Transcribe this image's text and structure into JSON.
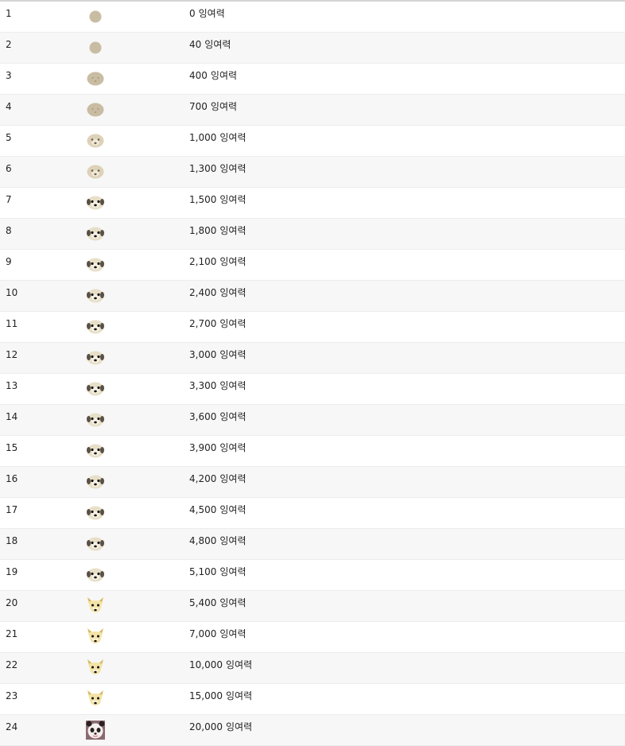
{
  "table": {
    "rows": [
      {
        "level": "1",
        "icon": "blank-circle-icon",
        "amount": "0",
        "unit": "잉여력"
      },
      {
        "level": "2",
        "icon": "blank-circle-icon",
        "amount": "40",
        "unit": "잉여력"
      },
      {
        "level": "3",
        "icon": "faint-face-icon",
        "amount": "400",
        "unit": "잉여력"
      },
      {
        "level": "4",
        "icon": "faint-face-icon",
        "amount": "700",
        "unit": "잉여력"
      },
      {
        "level": "5",
        "icon": "light-dog-face-icon",
        "amount": "1,000",
        "unit": "잉여력"
      },
      {
        "level": "6",
        "icon": "light-dog-face-icon",
        "amount": "1,300",
        "unit": "잉여력"
      },
      {
        "level": "7",
        "icon": "dog-face-icon",
        "amount": "1,500",
        "unit": "잉여력"
      },
      {
        "level": "8",
        "icon": "dog-face-icon",
        "amount": "1,800",
        "unit": "잉여력"
      },
      {
        "level": "9",
        "icon": "dog-face-icon",
        "amount": "2,100",
        "unit": "잉여력"
      },
      {
        "level": "10",
        "icon": "dog-face-icon",
        "amount": "2,400",
        "unit": "잉여력"
      },
      {
        "level": "11",
        "icon": "dog-face-icon",
        "amount": "2,700",
        "unit": "잉여력"
      },
      {
        "level": "12",
        "icon": "dog-face-icon",
        "amount": "3,000",
        "unit": "잉여력"
      },
      {
        "level": "13",
        "icon": "dog-face-icon",
        "amount": "3,300",
        "unit": "잉여력"
      },
      {
        "level": "14",
        "icon": "dog-face-icon",
        "amount": "3,600",
        "unit": "잉여력"
      },
      {
        "level": "15",
        "icon": "dog-face-icon",
        "amount": "3,900",
        "unit": "잉여력"
      },
      {
        "level": "16",
        "icon": "dog-face-icon",
        "amount": "4,200",
        "unit": "잉여력"
      },
      {
        "level": "17",
        "icon": "dog-face-icon",
        "amount": "4,500",
        "unit": "잉여력"
      },
      {
        "level": "18",
        "icon": "dog-face-icon",
        "amount": "4,800",
        "unit": "잉여력"
      },
      {
        "level": "19",
        "icon": "dog-face-icon",
        "amount": "5,100",
        "unit": "잉여력"
      },
      {
        "level": "20",
        "icon": "fox-face-icon",
        "amount": "5,400",
        "unit": "잉여력"
      },
      {
        "level": "21",
        "icon": "fox-face-icon",
        "amount": "7,000",
        "unit": "잉여력"
      },
      {
        "level": "22",
        "icon": "fox-face-icon",
        "amount": "10,000",
        "unit": "잉여력"
      },
      {
        "level": "23",
        "icon": "fox-face-icon",
        "amount": "15,000",
        "unit": "잉여력"
      },
      {
        "level": "24",
        "icon": "panda-face-icon",
        "amount": "20,000",
        "unit": "잉여력"
      }
    ]
  },
  "colors": {
    "blank_circle": "#c8bca2",
    "dog_face": "#e8dfc8",
    "fox_face": "#f3e3a6",
    "feature_dark": "#111111"
  }
}
